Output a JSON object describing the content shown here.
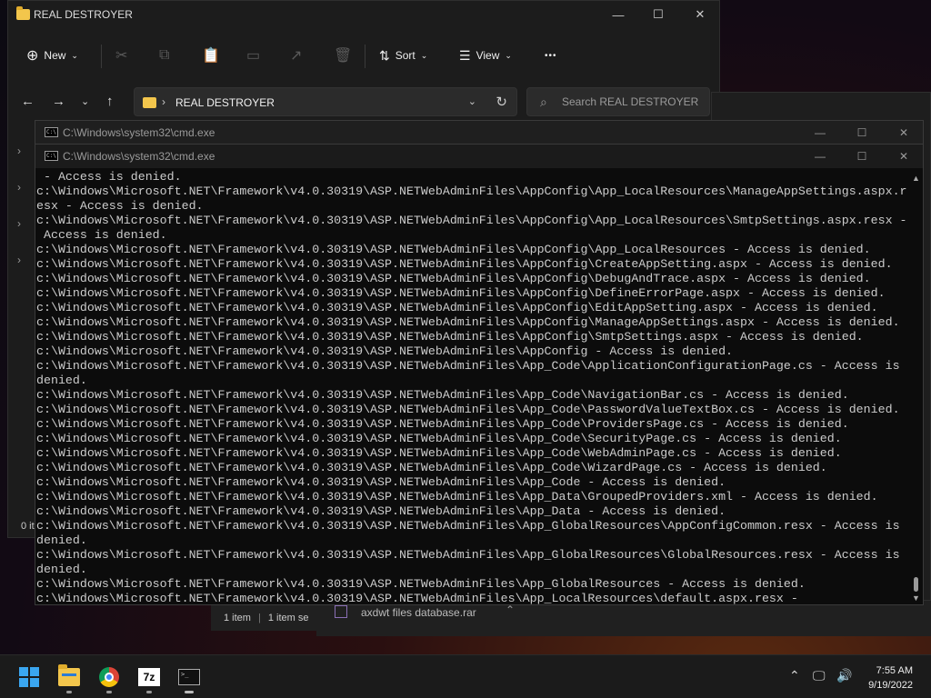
{
  "explorer": {
    "title": "REAL DESTROYER",
    "new_label": "New",
    "sort_label": "Sort",
    "view_label": "View",
    "more_label": "•••",
    "address": "REAL DESTROYER",
    "search_placeholder": "Search REAL DESTROYER",
    "status_items": "0 it"
  },
  "explorer2": {
    "status_count": "1 item",
    "status_selected": "1 item se",
    "download_name": "axdwt files database.rar"
  },
  "cmd_back": {
    "title": "C:\\Windows\\system32\\cmd.exe"
  },
  "cmd_front": {
    "title": "C:\\Windows\\system32\\cmd.exe",
    "lines": [
      " - Access is denied.",
      "c:\\Windows\\Microsoft.NET\\Framework\\v4.0.30319\\ASP.NETWebAdminFiles\\AppConfig\\App_LocalResources\\ManageAppSettings.aspx.r",
      "esx - Access is denied.",
      "c:\\Windows\\Microsoft.NET\\Framework\\v4.0.30319\\ASP.NETWebAdminFiles\\AppConfig\\App_LocalResources\\SmtpSettings.aspx.resx -",
      " Access is denied.",
      "c:\\Windows\\Microsoft.NET\\Framework\\v4.0.30319\\ASP.NETWebAdminFiles\\AppConfig\\App_LocalResources - Access is denied.",
      "c:\\Windows\\Microsoft.NET\\Framework\\v4.0.30319\\ASP.NETWebAdminFiles\\AppConfig\\CreateAppSetting.aspx - Access is denied.",
      "c:\\Windows\\Microsoft.NET\\Framework\\v4.0.30319\\ASP.NETWebAdminFiles\\AppConfig\\DebugAndTrace.aspx - Access is denied.",
      "c:\\Windows\\Microsoft.NET\\Framework\\v4.0.30319\\ASP.NETWebAdminFiles\\AppConfig\\DefineErrorPage.aspx - Access is denied.",
      "c:\\Windows\\Microsoft.NET\\Framework\\v4.0.30319\\ASP.NETWebAdminFiles\\AppConfig\\EditAppSetting.aspx - Access is denied.",
      "c:\\Windows\\Microsoft.NET\\Framework\\v4.0.30319\\ASP.NETWebAdminFiles\\AppConfig\\ManageAppSettings.aspx - Access is denied.",
      "c:\\Windows\\Microsoft.NET\\Framework\\v4.0.30319\\ASP.NETWebAdminFiles\\AppConfig\\SmtpSettings.aspx - Access is denied.",
      "c:\\Windows\\Microsoft.NET\\Framework\\v4.0.30319\\ASP.NETWebAdminFiles\\AppConfig - Access is denied.",
      "c:\\Windows\\Microsoft.NET\\Framework\\v4.0.30319\\ASP.NETWebAdminFiles\\App_Code\\ApplicationConfigurationPage.cs - Access is",
      "denied.",
      "c:\\Windows\\Microsoft.NET\\Framework\\v4.0.30319\\ASP.NETWebAdminFiles\\App_Code\\NavigationBar.cs - Access is denied.",
      "c:\\Windows\\Microsoft.NET\\Framework\\v4.0.30319\\ASP.NETWebAdminFiles\\App_Code\\PasswordValueTextBox.cs - Access is denied.",
      "c:\\Windows\\Microsoft.NET\\Framework\\v4.0.30319\\ASP.NETWebAdminFiles\\App_Code\\ProvidersPage.cs - Access is denied.",
      "c:\\Windows\\Microsoft.NET\\Framework\\v4.0.30319\\ASP.NETWebAdminFiles\\App_Code\\SecurityPage.cs - Access is denied.",
      "c:\\Windows\\Microsoft.NET\\Framework\\v4.0.30319\\ASP.NETWebAdminFiles\\App_Code\\WebAdminPage.cs - Access is denied.",
      "c:\\Windows\\Microsoft.NET\\Framework\\v4.0.30319\\ASP.NETWebAdminFiles\\App_Code\\WizardPage.cs - Access is denied.",
      "c:\\Windows\\Microsoft.NET\\Framework\\v4.0.30319\\ASP.NETWebAdminFiles\\App_Code - Access is denied.",
      "c:\\Windows\\Microsoft.NET\\Framework\\v4.0.30319\\ASP.NETWebAdminFiles\\App_Data\\GroupedProviders.xml - Access is denied.",
      "c:\\Windows\\Microsoft.NET\\Framework\\v4.0.30319\\ASP.NETWebAdminFiles\\App_Data - Access is denied.",
      "c:\\Windows\\Microsoft.NET\\Framework\\v4.0.30319\\ASP.NETWebAdminFiles\\App_GlobalResources\\AppConfigCommon.resx - Access is",
      "denied.",
      "c:\\Windows\\Microsoft.NET\\Framework\\v4.0.30319\\ASP.NETWebAdminFiles\\App_GlobalResources\\GlobalResources.resx - Access is",
      "denied.",
      "c:\\Windows\\Microsoft.NET\\Framework\\v4.0.30319\\ASP.NETWebAdminFiles\\App_GlobalResources - Access is denied.",
      "c:\\Windows\\Microsoft.NET\\Framework\\v4.0.30319\\ASP.NETWebAdminFiles\\App_LocalResources\\default.aspx.resx -"
    ]
  },
  "taskbar": {
    "sevenzip_label": "7z",
    "time": "7:55 AM",
    "date": "9/19/2022"
  },
  "colors": {
    "folder": "#f3c64c",
    "accent": "#3aa6f0",
    "console_text": "#cccccc"
  }
}
